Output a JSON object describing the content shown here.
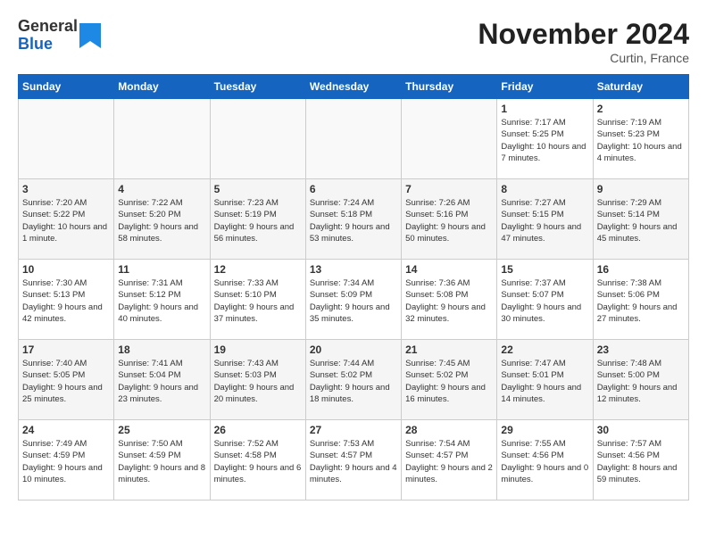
{
  "header": {
    "logo_line1": "General",
    "logo_line2": "Blue",
    "month_title": "November 2024",
    "location": "Curtin, France"
  },
  "weekdays": [
    "Sunday",
    "Monday",
    "Tuesday",
    "Wednesday",
    "Thursday",
    "Friday",
    "Saturday"
  ],
  "weeks": [
    [
      {
        "day": "",
        "info": ""
      },
      {
        "day": "",
        "info": ""
      },
      {
        "day": "",
        "info": ""
      },
      {
        "day": "",
        "info": ""
      },
      {
        "day": "",
        "info": ""
      },
      {
        "day": "1",
        "info": "Sunrise: 7:17 AM\nSunset: 5:25 PM\nDaylight: 10 hours and 7 minutes."
      },
      {
        "day": "2",
        "info": "Sunrise: 7:19 AM\nSunset: 5:23 PM\nDaylight: 10 hours and 4 minutes."
      }
    ],
    [
      {
        "day": "3",
        "info": "Sunrise: 7:20 AM\nSunset: 5:22 PM\nDaylight: 10 hours and 1 minute."
      },
      {
        "day": "4",
        "info": "Sunrise: 7:22 AM\nSunset: 5:20 PM\nDaylight: 9 hours and 58 minutes."
      },
      {
        "day": "5",
        "info": "Sunrise: 7:23 AM\nSunset: 5:19 PM\nDaylight: 9 hours and 56 minutes."
      },
      {
        "day": "6",
        "info": "Sunrise: 7:24 AM\nSunset: 5:18 PM\nDaylight: 9 hours and 53 minutes."
      },
      {
        "day": "7",
        "info": "Sunrise: 7:26 AM\nSunset: 5:16 PM\nDaylight: 9 hours and 50 minutes."
      },
      {
        "day": "8",
        "info": "Sunrise: 7:27 AM\nSunset: 5:15 PM\nDaylight: 9 hours and 47 minutes."
      },
      {
        "day": "9",
        "info": "Sunrise: 7:29 AM\nSunset: 5:14 PM\nDaylight: 9 hours and 45 minutes."
      }
    ],
    [
      {
        "day": "10",
        "info": "Sunrise: 7:30 AM\nSunset: 5:13 PM\nDaylight: 9 hours and 42 minutes."
      },
      {
        "day": "11",
        "info": "Sunrise: 7:31 AM\nSunset: 5:12 PM\nDaylight: 9 hours and 40 minutes."
      },
      {
        "day": "12",
        "info": "Sunrise: 7:33 AM\nSunset: 5:10 PM\nDaylight: 9 hours and 37 minutes."
      },
      {
        "day": "13",
        "info": "Sunrise: 7:34 AM\nSunset: 5:09 PM\nDaylight: 9 hours and 35 minutes."
      },
      {
        "day": "14",
        "info": "Sunrise: 7:36 AM\nSunset: 5:08 PM\nDaylight: 9 hours and 32 minutes."
      },
      {
        "day": "15",
        "info": "Sunrise: 7:37 AM\nSunset: 5:07 PM\nDaylight: 9 hours and 30 minutes."
      },
      {
        "day": "16",
        "info": "Sunrise: 7:38 AM\nSunset: 5:06 PM\nDaylight: 9 hours and 27 minutes."
      }
    ],
    [
      {
        "day": "17",
        "info": "Sunrise: 7:40 AM\nSunset: 5:05 PM\nDaylight: 9 hours and 25 minutes."
      },
      {
        "day": "18",
        "info": "Sunrise: 7:41 AM\nSunset: 5:04 PM\nDaylight: 9 hours and 23 minutes."
      },
      {
        "day": "19",
        "info": "Sunrise: 7:43 AM\nSunset: 5:03 PM\nDaylight: 9 hours and 20 minutes."
      },
      {
        "day": "20",
        "info": "Sunrise: 7:44 AM\nSunset: 5:02 PM\nDaylight: 9 hours and 18 minutes."
      },
      {
        "day": "21",
        "info": "Sunrise: 7:45 AM\nSunset: 5:02 PM\nDaylight: 9 hours and 16 minutes."
      },
      {
        "day": "22",
        "info": "Sunrise: 7:47 AM\nSunset: 5:01 PM\nDaylight: 9 hours and 14 minutes."
      },
      {
        "day": "23",
        "info": "Sunrise: 7:48 AM\nSunset: 5:00 PM\nDaylight: 9 hours and 12 minutes."
      }
    ],
    [
      {
        "day": "24",
        "info": "Sunrise: 7:49 AM\nSunset: 4:59 PM\nDaylight: 9 hours and 10 minutes."
      },
      {
        "day": "25",
        "info": "Sunrise: 7:50 AM\nSunset: 4:59 PM\nDaylight: 9 hours and 8 minutes."
      },
      {
        "day": "26",
        "info": "Sunrise: 7:52 AM\nSunset: 4:58 PM\nDaylight: 9 hours and 6 minutes."
      },
      {
        "day": "27",
        "info": "Sunrise: 7:53 AM\nSunset: 4:57 PM\nDaylight: 9 hours and 4 minutes."
      },
      {
        "day": "28",
        "info": "Sunrise: 7:54 AM\nSunset: 4:57 PM\nDaylight: 9 hours and 2 minutes."
      },
      {
        "day": "29",
        "info": "Sunrise: 7:55 AM\nSunset: 4:56 PM\nDaylight: 9 hours and 0 minutes."
      },
      {
        "day": "30",
        "info": "Sunrise: 7:57 AM\nSunset: 4:56 PM\nDaylight: 8 hours and 59 minutes."
      }
    ]
  ]
}
